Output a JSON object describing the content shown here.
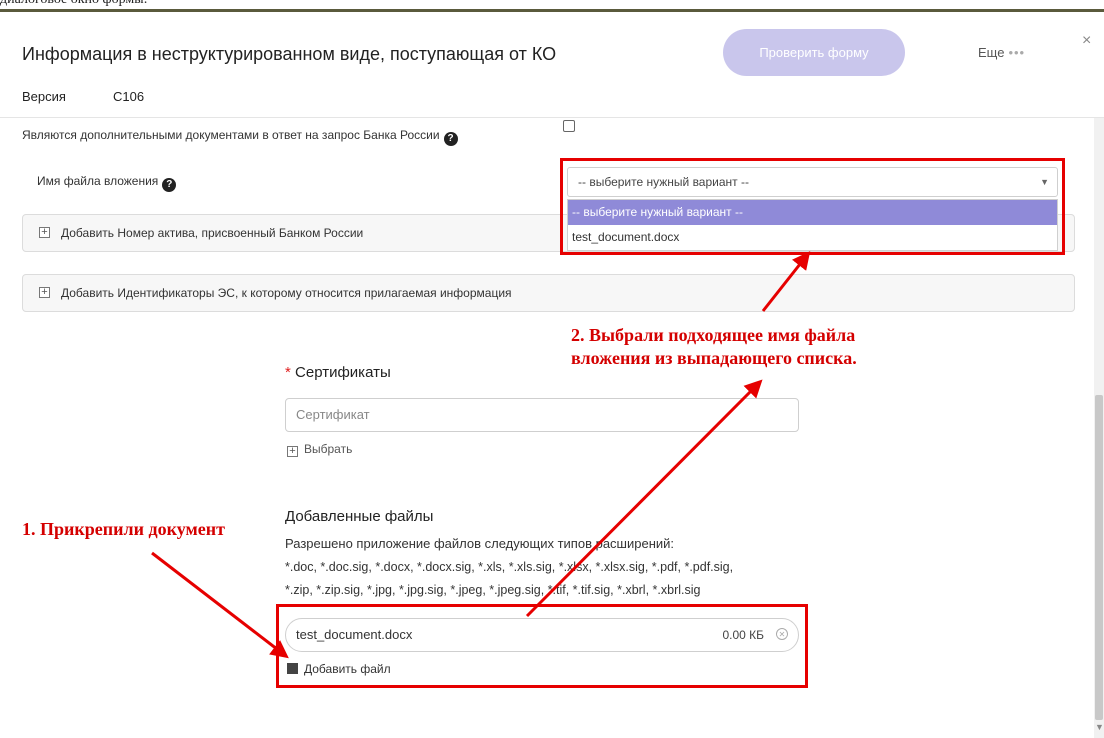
{
  "caption": "диалоговое окно формы:",
  "header": {
    "title": "Информация в неструктурированном виде, поступающая от КО",
    "check_button": "Проверить форму",
    "more_label": "Еще",
    "more_dots": "•••",
    "close": "×",
    "version_label": "Версия",
    "version_value": "С106"
  },
  "form": {
    "additional_docs_label": "Являются дополнительными документами в ответ на запрос Банка России",
    "attachment_name_label": "Имя файла вложения",
    "help_glyph": "?",
    "select_value": "-- выберите нужный вариант --",
    "select_options": [
      "-- выберите нужный вариант --",
      "test_document.docx"
    ],
    "panels": [
      "Добавить Номер актива, присвоенный Банком России",
      "Добавить Идентификаторы ЭС, к которому относится прилагаемая информация"
    ]
  },
  "certificates": {
    "required_mark": "*",
    "title": "Сертификаты",
    "placeholder": "Сертификат",
    "choose_label": "Выбрать"
  },
  "files": {
    "title": "Добавленные файлы",
    "allowed_intro": "Разрешено приложение файлов следующих типов расширений:",
    "allowed_line1": "*.doc, *.doc.sig, *.docx, *.docx.sig, *.xls, *.xls.sig, *.xlsx, *.xlsx.sig, *.pdf, *.pdf.sig,",
    "allowed_line2": "*.zip, *.zip.sig, *.jpg, *.jpg.sig, *.jpeg, *.jpeg.sig, *.tif, *.tif.sig, *.xbrl, *.xbrl.sig",
    "file_name": "test_document.docx",
    "file_size": "0.00 КБ",
    "add_file_label": "Добавить файл"
  },
  "annotations": {
    "step1": "1. Прикрепили документ",
    "step2_line1": "2. Выбрали подходящее имя файла",
    "step2_line2": "вложения из выпадающего списка."
  },
  "colors": {
    "annotation_red": "#e60000",
    "button_bg": "#c9c6ec",
    "selected_option": "#8f8ad8"
  }
}
